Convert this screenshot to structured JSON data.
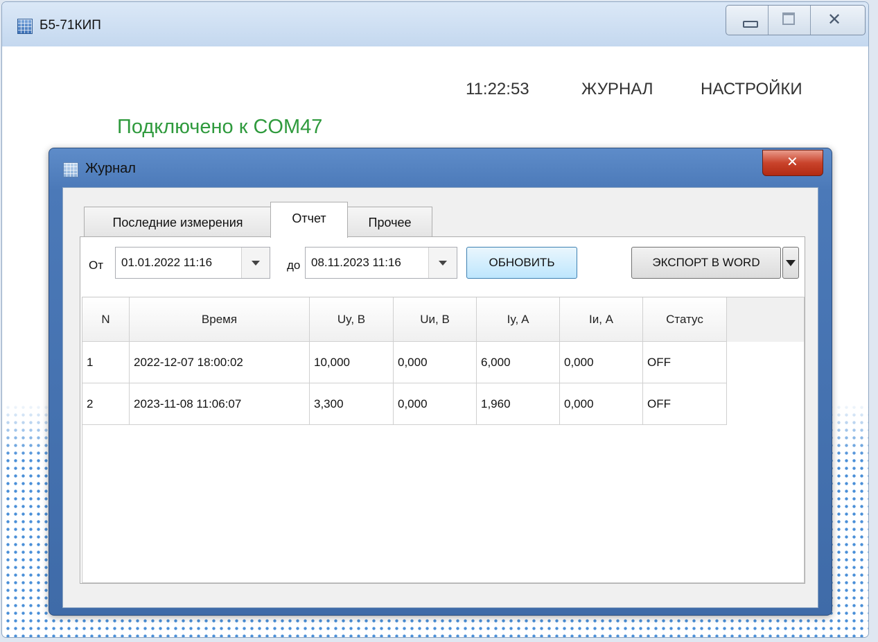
{
  "app": {
    "title": "Б5-71КИП",
    "clock": "11:22:53",
    "nav_journal": "ЖУРНАЛ",
    "nav_settings": "НАСТРОЙКИ",
    "status": "Подключено к COM47",
    "status_color": "#2f9a3d"
  },
  "dialog": {
    "title": "Журнал",
    "tabs": [
      {
        "label": "Последние измерения"
      },
      {
        "label": "Отчет",
        "selected": true
      },
      {
        "label": "Прочее"
      }
    ],
    "from_label": "От",
    "from_value": "01.01.2022 11:16",
    "to_label": "до",
    "to_value": "08.11.2023 11:16",
    "refresh_label": "ОБНОВИТЬ",
    "export_label": "ЭКСПОРТ В WORD"
  },
  "grid": {
    "columns": [
      "N",
      "Время",
      "Uy, B",
      "Uи, B",
      "Iy, A",
      "Iи, A",
      "Статус"
    ],
    "rows": [
      [
        "1",
        "2022-12-07 18:00:02",
        "10,000",
        "0,000",
        "6,000",
        "0,000",
        "OFF"
      ],
      [
        "2",
        "2023-11-08 11:06:07",
        "3,300",
        "0,000",
        "1,960",
        "0,000",
        "OFF"
      ]
    ]
  }
}
